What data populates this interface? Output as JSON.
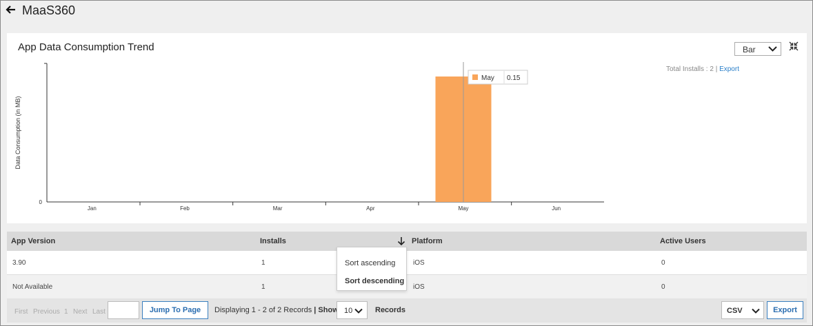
{
  "app": {
    "title": "MaaS360"
  },
  "chart_panel": {
    "title": "App Data Consumption Trend",
    "chart_type_select": "Bar",
    "installs_label": "Total Installs : 2 |",
    "export_link": "Export"
  },
  "chart_data": {
    "type": "bar",
    "categories": [
      "Jan",
      "Feb",
      "Mar",
      "Apr",
      "May",
      "Jun"
    ],
    "values": [
      null,
      null,
      null,
      null,
      0.15,
      null
    ],
    "ylabel": "Data Consumption (in MB)",
    "xlabel": "",
    "y_tick_labels": [
      "0"
    ],
    "bar_color": "#f9a55a",
    "tooltip": {
      "label": "May",
      "value": "0.15"
    }
  },
  "table": {
    "columns": [
      "App Version",
      "Installs",
      "Platform",
      "Active Users"
    ],
    "rows": [
      [
        "3.90",
        "1",
        "iOS",
        "0"
      ],
      [
        "Not Available",
        "1",
        "iOS",
        "0"
      ]
    ]
  },
  "sort_menu": {
    "ascending": "Sort ascending",
    "descending": "Sort descending"
  },
  "pagination": {
    "first": "First",
    "previous": "Previous",
    "page": "1",
    "next": "Next",
    "last": "Last",
    "page_input_value": "",
    "jump_button": "Jump To Page",
    "displaying": "Displaying 1 - 2 of 2 Records",
    "show_label": "| Show",
    "page_size": "10",
    "records_label": "Records",
    "export_format": "CSV",
    "export_button": "Export"
  },
  "colors": {
    "accent": "#2a7fc9",
    "bar": "#f9a55a",
    "header_bg": "#d9d9d9"
  }
}
